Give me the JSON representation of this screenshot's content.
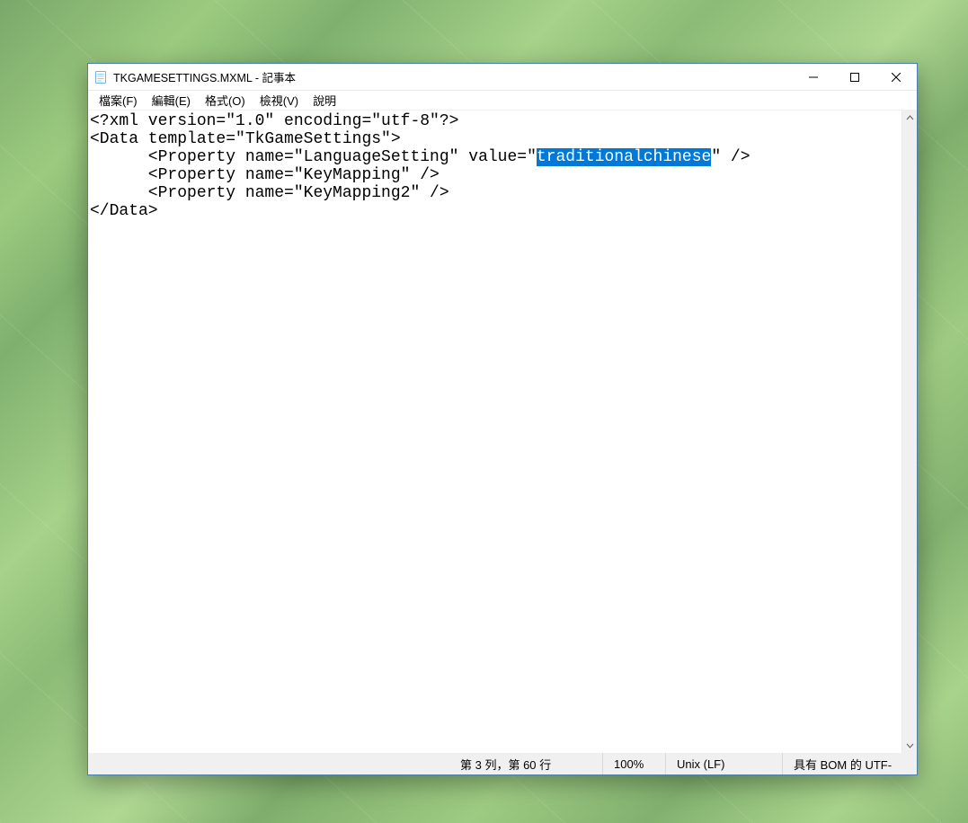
{
  "window": {
    "title": "TKGAMESETTINGS.MXML - 記事本",
    "controls": {
      "minimize": "minimize-icon",
      "maximize": "maximize-icon",
      "close": "close-icon"
    }
  },
  "menubar": {
    "file": "檔案(F)",
    "edit": "編輯(E)",
    "format": "格式(O)",
    "view": "檢視(V)",
    "help": "說明"
  },
  "editor": {
    "l1": "<?xml version=\"1.0\" encoding=\"utf-8\"?>",
    "l2": "<Data template=\"TkGameSettings\">",
    "l3a": "      <Property name=\"LanguageSetting\" value=\"",
    "l3_sel": "traditionalchinese",
    "l3b": "\" />",
    "l4": "      <Property name=\"KeyMapping\" />",
    "l5": "      <Property name=\"KeyMapping2\" />",
    "l6": "</Data>"
  },
  "statusbar": {
    "position": "第 3 列，第 60 行",
    "zoom": "100%",
    "line_ending": "Unix (LF)",
    "encoding": "具有 BOM 的 UTF-"
  }
}
